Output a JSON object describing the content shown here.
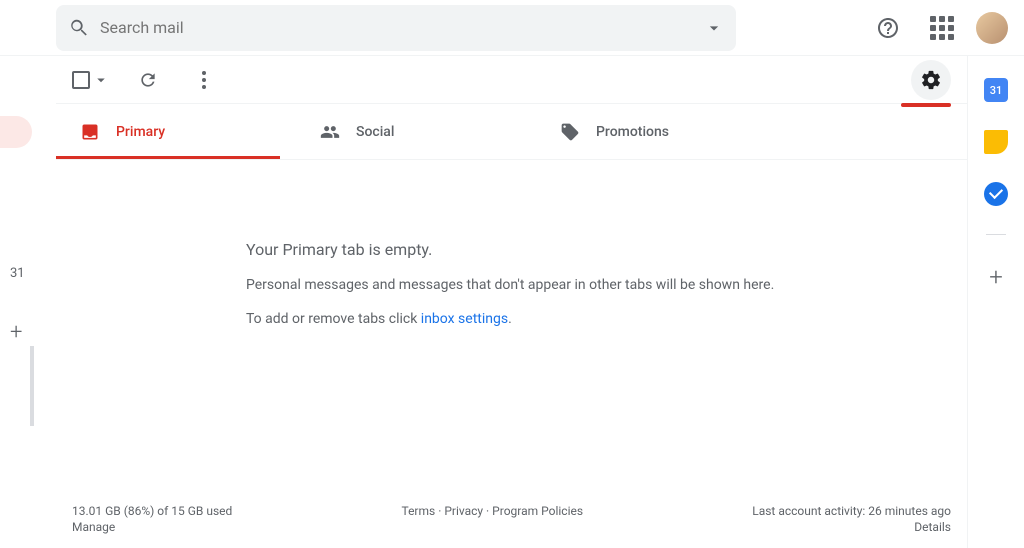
{
  "search": {
    "placeholder": "Search mail"
  },
  "left": {
    "number": "31"
  },
  "tabs": {
    "primary": "Primary",
    "social": "Social",
    "promotions": "Promotions"
  },
  "empty": {
    "heading": "Your Primary tab is empty.",
    "subtext": "Personal messages and messages that don't appear in other tabs will be shown here.",
    "add_prefix": "To add or remove tabs click ",
    "add_link": "inbox settings",
    "add_suffix": "."
  },
  "footer": {
    "storage": "13.01 GB (86%) of 15 GB used",
    "manage": "Manage",
    "terms": "Terms",
    "privacy": "Privacy",
    "policies": "Program Policies",
    "sep": " · ",
    "activity": "Last account activity: 26 minutes ago",
    "details": "Details"
  },
  "rail": {
    "calendar_day": "31"
  }
}
